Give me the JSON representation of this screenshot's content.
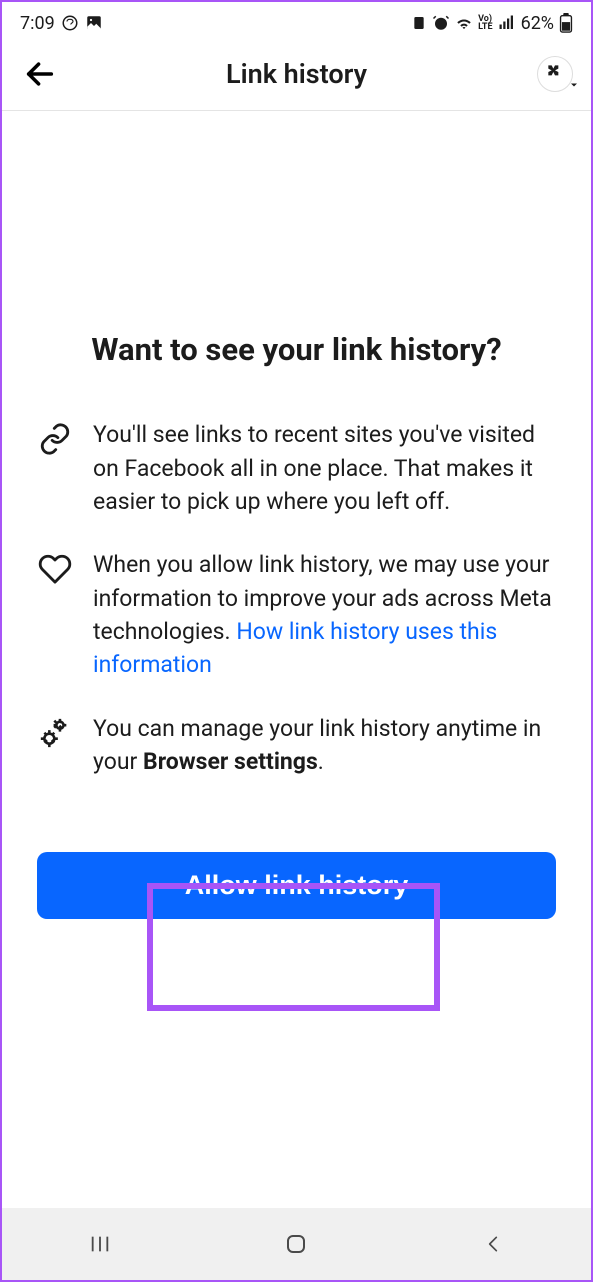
{
  "statusBar": {
    "time": "7:09",
    "battery": "62%"
  },
  "header": {
    "title": "Link history"
  },
  "content": {
    "heroTitle": "Want to see your link history?",
    "items": [
      {
        "text": "You'll see links to recent sites you've visited on Facebook all in one place. That makes it easier to pick up where you left off."
      },
      {
        "text": "When you allow link history, we may use your information to improve your ads across Meta technologies. ",
        "linkText": "How link history uses this information"
      },
      {
        "textPrefix": "You can manage your link history anytime in your ",
        "boldText": "Browser settings",
        "textSuffix": "."
      }
    ],
    "allowButton": "Allow link history"
  }
}
